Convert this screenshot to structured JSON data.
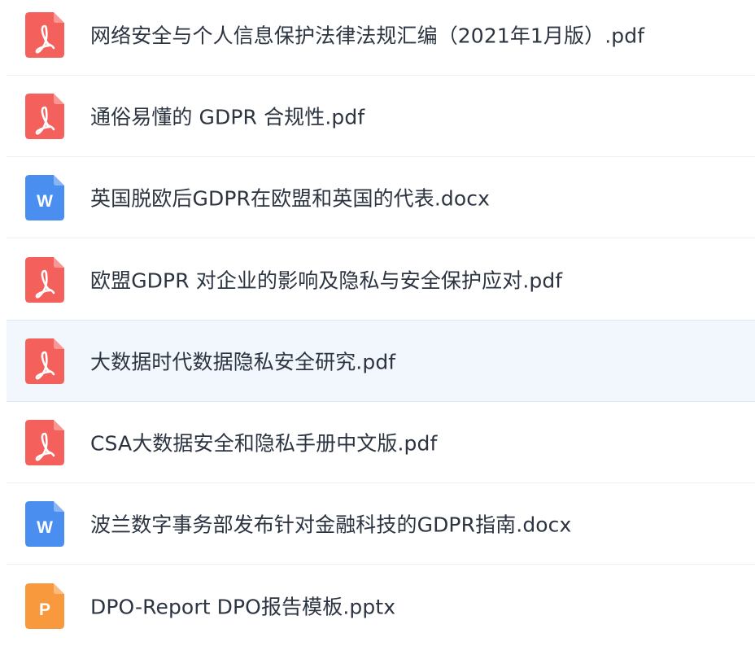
{
  "files": [
    {
      "name": "网络安全与个人信息保护法律法规汇编（2021年1月版）.pdf",
      "icon": "pdf-icon",
      "icon_color": "#f4605b",
      "icon_glyph": "pdf"
    },
    {
      "name": "通俗易懂的 GDPR 合规性.pdf",
      "icon": "pdf-icon",
      "icon_color": "#f4605b",
      "icon_glyph": "pdf"
    },
    {
      "name": "英国脱欧后GDPR在欧盟和英国的代表.docx",
      "icon": "word-icon",
      "icon_color": "#4a8ef0",
      "icon_glyph": "W"
    },
    {
      "name": "欧盟GDPR 对企业的影响及隐私与安全保护应对.pdf",
      "icon": "pdf-icon",
      "icon_color": "#f4605b",
      "icon_glyph": "pdf"
    },
    {
      "name": "大数据时代数据隐私安全研究.pdf",
      "icon": "pdf-icon",
      "icon_color": "#f4605b",
      "icon_glyph": "pdf",
      "highlighted": true
    },
    {
      "name": "CSA大数据安全和隐私手册中文版.pdf",
      "icon": "pdf-icon",
      "icon_color": "#f4605b",
      "icon_glyph": "pdf"
    },
    {
      "name": "波兰数字事务部发布针对金融科技的GDPR指南.docx",
      "icon": "word-icon",
      "icon_color": "#4a8ef0",
      "icon_glyph": "W"
    },
    {
      "name": "DPO-Report DPO报告模板.pptx",
      "icon": "powerpoint-icon",
      "icon_color": "#f7993c",
      "icon_glyph": "P"
    }
  ]
}
